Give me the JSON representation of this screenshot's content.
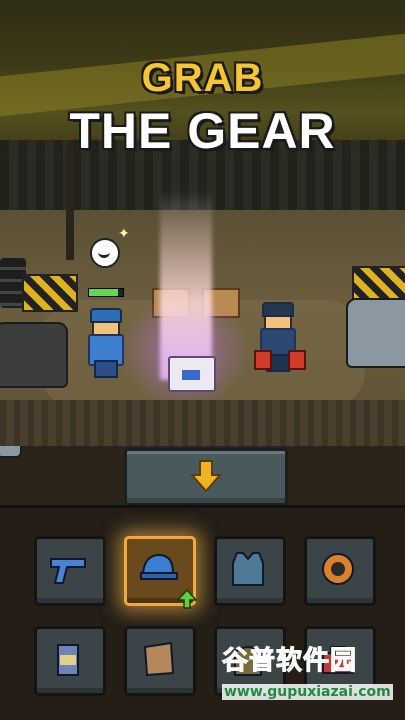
{
  "headline": {
    "line1": "GRAB",
    "line2": "THE GEAR"
  },
  "hud": {
    "health_fraction": 0.85
  },
  "drop_button": {
    "icon": "down-arrow-icon",
    "color": "#f2b21d"
  },
  "inventory": {
    "slots": [
      {
        "item": "pistol-icon",
        "selected": false
      },
      {
        "item": "baseball-cap-icon",
        "selected": true,
        "upgrade_indicator": "upgrade-arrow-icon"
      },
      {
        "item": "body-armor-vest-icon",
        "selected": false
      },
      {
        "item": "brass-knuckles-icon",
        "selected": false
      },
      {
        "item": "canned-food-icon",
        "selected": false
      },
      {
        "item": "cloth-scrap-icon",
        "selected": false
      },
      {
        "item": "backpack-icon",
        "selected": false
      },
      {
        "item": "toolbox-icon",
        "selected": false
      }
    ]
  },
  "watermark": {
    "chinese": "谷普软件园",
    "url": "www.gupuxiazai.com"
  },
  "colors": {
    "title_gold": "#f5c631",
    "selected_slot_glow": "#f2a93a",
    "upgrade_green": "#5ed33b"
  }
}
